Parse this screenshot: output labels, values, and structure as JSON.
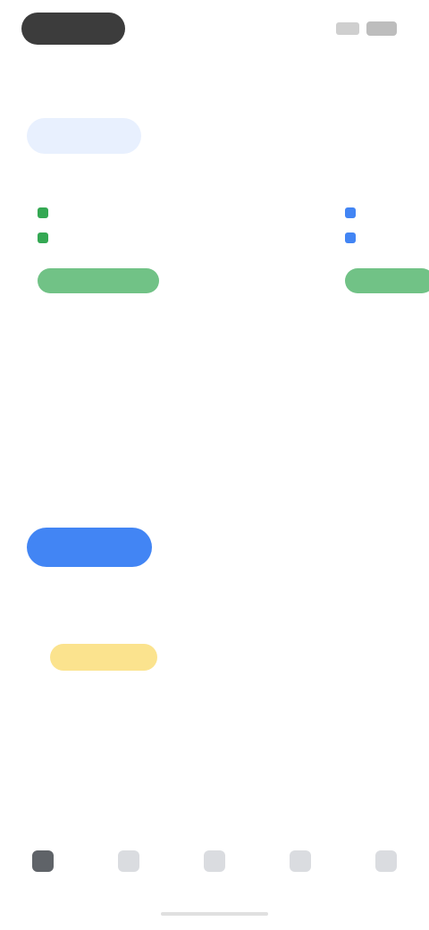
{
  "status_bar": {
    "pill_icon": "status-pill",
    "signal_icon": "signal-icon",
    "battery_icon": "battery-icon"
  },
  "header": {
    "title": ""
  },
  "tabs": [
    {
      "label": ""
    },
    {
      "label": ""
    },
    {
      "label": ""
    },
    {
      "label": ""
    },
    {
      "label": ""
    }
  ],
  "cards": [
    {
      "head": "",
      "segments": [
        {
          "line1": "",
          "line2": "",
          "line3": ""
        },
        {
          "line1": "",
          "line2": "",
          "line3": ""
        }
      ],
      "price": "",
      "select_label": "",
      "accent": "#34a853"
    },
    {
      "head": "",
      "segments": [
        {
          "line1": "",
          "line2": "",
          "line3": ""
        },
        {
          "line1": "",
          "line2": "",
          "line3": ""
        }
      ],
      "price": "",
      "select_label": "",
      "accent": "#4285f4"
    }
  ],
  "more_link": "",
  "primary_button": "",
  "promo": {
    "badge": "",
    "title": "",
    "body": "",
    "action": ""
  },
  "bottom_nav": [
    {
      "label": "",
      "icon": "home-icon",
      "active": true
    },
    {
      "label": "",
      "icon": "search-icon",
      "active": false
    },
    {
      "label": "",
      "icon": "bookmark-icon",
      "active": false
    },
    {
      "label": "",
      "icon": "bell-icon",
      "active": false
    },
    {
      "label": "",
      "icon": "profile-icon",
      "active": false
    }
  ],
  "colors": {
    "primary": "#4285f4",
    "success": "#34a853",
    "highlight": "#fbe38e",
    "tab_active_bg": "#e8f0fe"
  }
}
